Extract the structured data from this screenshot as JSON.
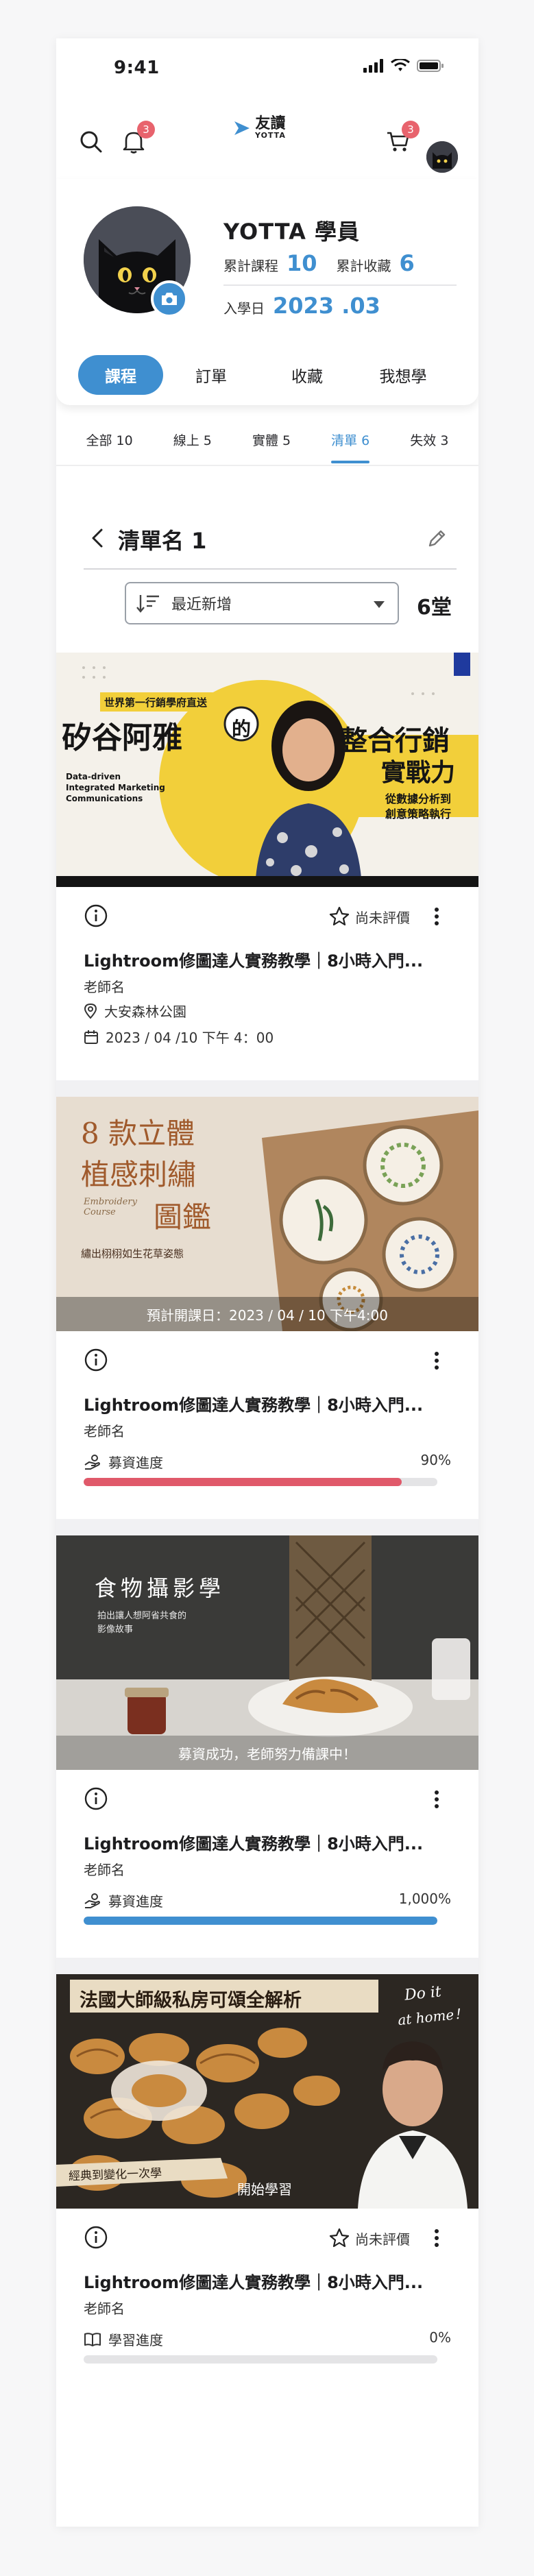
{
  "status_bar": {
    "time": "9:41"
  },
  "top_nav": {
    "notification_badge": "3",
    "cart_badge": "3",
    "logo_cn": "友讀",
    "logo_en": "YOTTA"
  },
  "profile": {
    "name": "YOTTA 學員",
    "courses_label": "累計課程",
    "courses_value": "10",
    "favorites_label": "累計收藏",
    "favorites_value": "6",
    "join_label": "入學日",
    "join_value": "2023 .03"
  },
  "main_tabs": [
    "課程",
    "訂單",
    "收藏",
    "我想學"
  ],
  "sub_tabs": [
    "全部 10",
    "線上 5",
    "實體 5",
    "清單 6",
    "失效 3"
  ],
  "list": {
    "title": "清單名 1",
    "sort_label": "最近新增",
    "count": "6堂"
  },
  "courses": [
    {
      "banner": {
        "tag": "世界第一行銷學府直送",
        "title_left": "矽谷阿雅",
        "de": "的",
        "title_right_1": "整合行銷",
        "title_right_2": "實戰力",
        "subtitle_1": "從數據分析到",
        "subtitle_2": "創意策略執行",
        "en_1": "Data-driven",
        "en_2": "Integrated Marketing",
        "en_3": "Communications"
      },
      "rate_label": "尚未評價",
      "title": "Lightroom修圖達人實務教學｜8小時入門...",
      "teacher": "老師名",
      "location": "大安森林公園",
      "datetime": "2023 / 04 /10 下午 4：00"
    },
    {
      "banner": {
        "title_1": "8 款立體",
        "title_2": "植感刺繡",
        "title_3": "圖鑑",
        "en": "Embroidery Course",
        "sub": "繡出栩栩如生花草姿態",
        "caption": "預計開課日：2023 / 04 / 10 下午4:00"
      },
      "title": "Lightroom修圖達人實務教學｜8小時入門...",
      "teacher": "老師名",
      "progress_label": "募資進度",
      "progress_pct": "90%",
      "progress_value": 0.9,
      "progress_color": "#e0596a"
    },
    {
      "banner": {
        "title": "食物攝影學",
        "sub_1": "拍出讓人想阿省共食的",
        "sub_2": "影像故事",
        "caption": "募資成功，老師努力備課中！"
      },
      "title": "Lightroom修圖達人實務教學｜8小時入門...",
      "teacher": "老師名",
      "progress_label": "募資進度",
      "progress_pct": "1,000%",
      "progress_value": 1.0,
      "progress_color": "#3f8fd0"
    },
    {
      "banner": {
        "title": "法國大師級私房可頌全解析",
        "script_1": "Do it",
        "script_2": "at home！",
        "ribbon": "經典到變化一次學",
        "caption": "開始學習"
      },
      "rate_label": "尚未評價",
      "title": "Lightroom修圖達人實務教學｜8小時入門...",
      "teacher": "老師名",
      "progress_label": "學習進度",
      "progress_pct": "0%",
      "progress_value": 0.0,
      "progress_color": "#d3d3d6"
    }
  ],
  "colors": {
    "accent": "#3f8fd0",
    "badge": "#e8636d"
  }
}
